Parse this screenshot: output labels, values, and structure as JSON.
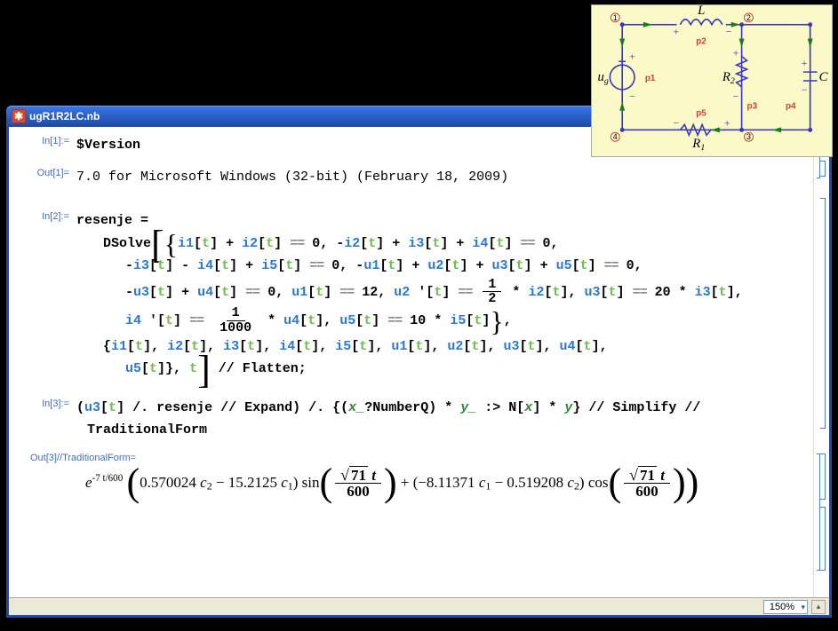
{
  "window": {
    "title": "ugR1R2LC.nb"
  },
  "cells": {
    "in1_label": "In[1]:=",
    "in1_code": "$Version",
    "out1_label": "Out[1]=",
    "out1_text": "7.0 for Microsoft Windows (32-bit) (February 18, 2009)",
    "in2_label": "In[2]:=",
    "in2_line1_a": "resenje =",
    "dsolve": "DSolve",
    "eq1": "i1[t] + i2[t] == 0",
    "eq2": "-i2[t] + i3[t] + i4[t] == 0",
    "eq3": "-i3[t] - i4[t] + i5[t] == 0",
    "eq4": "-u1[t] + u2[t] + u3[t] + u5[t] == 0",
    "eq5": "-u3[t] + u4[t] == 0",
    "eq6": "u1[t] == 12",
    "eq7_lhs": "u2'[t] ==",
    "eq7_frac_num": "1",
    "eq7_frac_den": "2",
    "eq7_rhs": "* i2[t]",
    "eq8": "u3[t] == 20 * i3[t]",
    "eq9_lhs": "i4'[t] ==",
    "eq9_frac_num": "1",
    "eq9_frac_den": "1000",
    "eq9_rhs": "* u4[t]",
    "eq10": "u5[t] == 10 * i5[t]",
    "vars": "{i1[t], i2[t], i3[t], i4[t], i5[t], u1[t], u2[t], u3[t], u4[t],",
    "vars2": "u5[t]}",
    "ivar": "t",
    "flatten": "// Flatten;",
    "in3_label": "In[3]:=",
    "in3_line1": "(u3[t] /. resenje // Expand) /. {(x_?NumberQ) * y_ :> N[x] * y} // Simplify //",
    "in3_line2": "TraditionalForm",
    "out3_label": "Out[3]//TraditionalForm=",
    "out3": {
      "exp_num": "-7 t/600",
      "coef1": "0.570024",
      "c2a": "c",
      "minus": "− 15.2125",
      "c1a": "c",
      "sin": "sin",
      "sqrt71": "71",
      "t": "t",
      "den600": "600",
      "plus": "+",
      "neg8": "(−8.11371",
      "c1b": "c",
      "minus2": "− 0.519208",
      "c2b": "c",
      "cos": "cos"
    }
  },
  "status": {
    "zoom": "150%"
  },
  "circuit": {
    "L": "L",
    "C": "C",
    "R1": "R₁",
    "R2": "R₂",
    "ug": "u",
    "p1": "p1",
    "p2": "p2",
    "p3": "p3",
    "p4": "p4",
    "p5": "p5",
    "n1": "1",
    "n2": "2",
    "n3": "3",
    "n4": "4"
  }
}
